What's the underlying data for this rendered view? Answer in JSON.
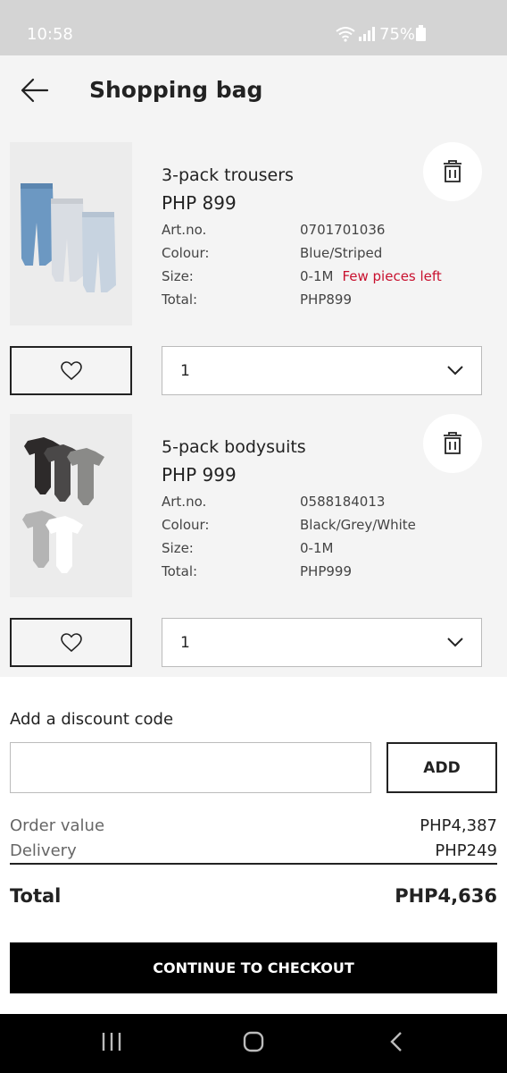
{
  "status_bar": {
    "time": "10:58",
    "battery": "75%"
  },
  "header": {
    "title": "Shopping bag"
  },
  "items": [
    {
      "name": "3-pack trousers",
      "price": "PHP 899",
      "attributes": [
        {
          "label": "Art.no.",
          "value": "0701701036"
        },
        {
          "label": "Colour:",
          "value": "Blue/Striped"
        },
        {
          "label": "Size:",
          "value": "0-1M"
        },
        {
          "label": "Total:",
          "value": "PHP899"
        }
      ],
      "stock_note": "Few pieces left",
      "quantity": "1",
      "colors": [
        "#6c98c2",
        "#d9dde3",
        "#c7d3e0"
      ]
    },
    {
      "name": "5-pack bodysuits",
      "price": "PHP 999",
      "attributes": [
        {
          "label": "Art.no.",
          "value": "0588184013"
        },
        {
          "label": "Colour:",
          "value": "Black/Grey/White"
        },
        {
          "label": "Size:",
          "value": "0-1M"
        },
        {
          "label": "Total:",
          "value": "PHP999"
        }
      ],
      "stock_note": "",
      "quantity": "1",
      "colors": [
        "#2d2a2a",
        "#4a4848",
        "#8a8a88",
        "#b4b4b4",
        "#ffffff"
      ]
    }
  ],
  "summary": {
    "discount_label": "Add a discount code",
    "discount_value": "",
    "add_label": "ADD",
    "order_value_label": "Order value",
    "order_value": "PHP4,387",
    "delivery_label": "Delivery",
    "delivery_value": "PHP249",
    "total_label": "Total",
    "total_value": "PHP4,636",
    "checkout_label": "CONTINUE TO CHECKOUT"
  },
  "nav": {
    "icons": [
      "recent-apps-icon",
      "home-icon",
      "back-nav-icon"
    ]
  },
  "colors": {
    "accent": "#000000",
    "warning": "#c8102e",
    "background": "#f4f4f4"
  }
}
